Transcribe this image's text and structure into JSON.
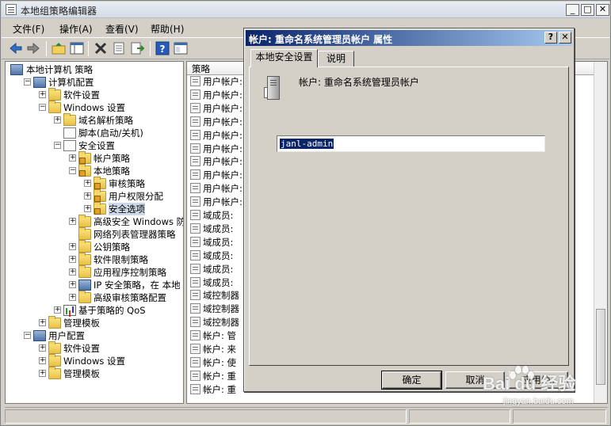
{
  "window": {
    "title": "本地组策略编辑器"
  },
  "menu": [
    "文件(F)",
    "操作(A)",
    "查看(V)",
    "帮助(H)"
  ],
  "tree": [
    {
      "label": "本地计算机 策略",
      "level": 0,
      "icon": "computer-policy-icon",
      "exp": ""
    },
    {
      "label": "计算机配置",
      "level": 1,
      "icon": "computer-icon",
      "exp": "-"
    },
    {
      "label": "软件设置",
      "level": 2,
      "icon": "folder-icon",
      "exp": "+"
    },
    {
      "label": "Windows 设置",
      "level": 2,
      "icon": "folder-icon",
      "exp": "-"
    },
    {
      "label": "域名解析策略",
      "level": 3,
      "icon": "folder-icon",
      "exp": "+"
    },
    {
      "label": "脚本(启动/关机)",
      "level": 3,
      "icon": "script-icon",
      "exp": ""
    },
    {
      "label": "安全设置",
      "level": 3,
      "icon": "security-icon",
      "exp": "-"
    },
    {
      "label": "帐户策略",
      "level": 4,
      "icon": "lock-folder-icon",
      "exp": "+"
    },
    {
      "label": "本地策略",
      "level": 4,
      "icon": "lock-folder-icon",
      "exp": "-"
    },
    {
      "label": "审核策略",
      "level": 5,
      "icon": "lock-folder-icon",
      "exp": "+"
    },
    {
      "label": "用户权限分配",
      "level": 5,
      "icon": "lock-folder-icon",
      "exp": "+"
    },
    {
      "label": "安全选项",
      "level": 5,
      "icon": "lock-folder-icon",
      "exp": "+",
      "selected": true
    },
    {
      "label": "高级安全 Windows 防火",
      "level": 4,
      "icon": "folder-icon",
      "exp": "+"
    },
    {
      "label": "网络列表管理器策略",
      "level": 4,
      "icon": "folder-icon",
      "exp": ""
    },
    {
      "label": "公钥策略",
      "level": 4,
      "icon": "folder-icon",
      "exp": "+"
    },
    {
      "label": "软件限制策略",
      "level": 4,
      "icon": "folder-icon",
      "exp": "+"
    },
    {
      "label": "应用程序控制策略",
      "level": 4,
      "icon": "folder-icon",
      "exp": "+"
    },
    {
      "label": "IP 安全策略，在 本地",
      "level": 4,
      "icon": "ipsec-icon",
      "exp": "+"
    },
    {
      "label": "高级审核策略配置",
      "level": 4,
      "icon": "folder-icon",
      "exp": "+"
    },
    {
      "label": "基于策略的 QoS",
      "level": 3,
      "icon": "qos-chart-icon",
      "exp": "+"
    },
    {
      "label": "管理模板",
      "level": 2,
      "icon": "folder-icon",
      "exp": "+"
    },
    {
      "label": "用户配置",
      "level": 1,
      "icon": "user-icon",
      "exp": "-"
    },
    {
      "label": "软件设置",
      "level": 2,
      "icon": "folder-icon",
      "exp": "+"
    },
    {
      "label": "Windows 设置",
      "level": 2,
      "icon": "folder-icon",
      "exp": "+"
    },
    {
      "label": "管理模板",
      "level": 2,
      "icon": "folder-icon",
      "exp": "+"
    }
  ],
  "list": {
    "header": "策略",
    "rows": [
      "用户帐户:",
      "用户帐户:",
      "用户帐户:",
      "用户帐户:",
      "用户帐户:",
      "用户帐户:",
      "用户帐户:",
      "用户帐户:",
      "用户帐户:",
      "用户帐户:",
      "域成员:",
      "域成员:",
      "域成员:",
      "域成员:",
      "域成员:",
      "域成员:",
      "域控制器",
      "域控制器",
      "域控制器",
      "帐户: 管",
      "帐户: 来",
      "帐户: 使",
      "帐户: 重",
      "帐户: 重"
    ]
  },
  "dialog": {
    "title": "帐户: 重命名系统管理员帐户 属性",
    "tabs": [
      "本地安全设置",
      "说明"
    ],
    "policy_name": "帐户: 重命名系统管理员帐户",
    "value": "janl-admin",
    "buttons": {
      "ok": "确定",
      "cancel": "取消",
      "apply": "应用(A)"
    }
  },
  "watermark": {
    "brand": "Bai du 经验",
    "url": "jingyan.baidu.com"
  }
}
